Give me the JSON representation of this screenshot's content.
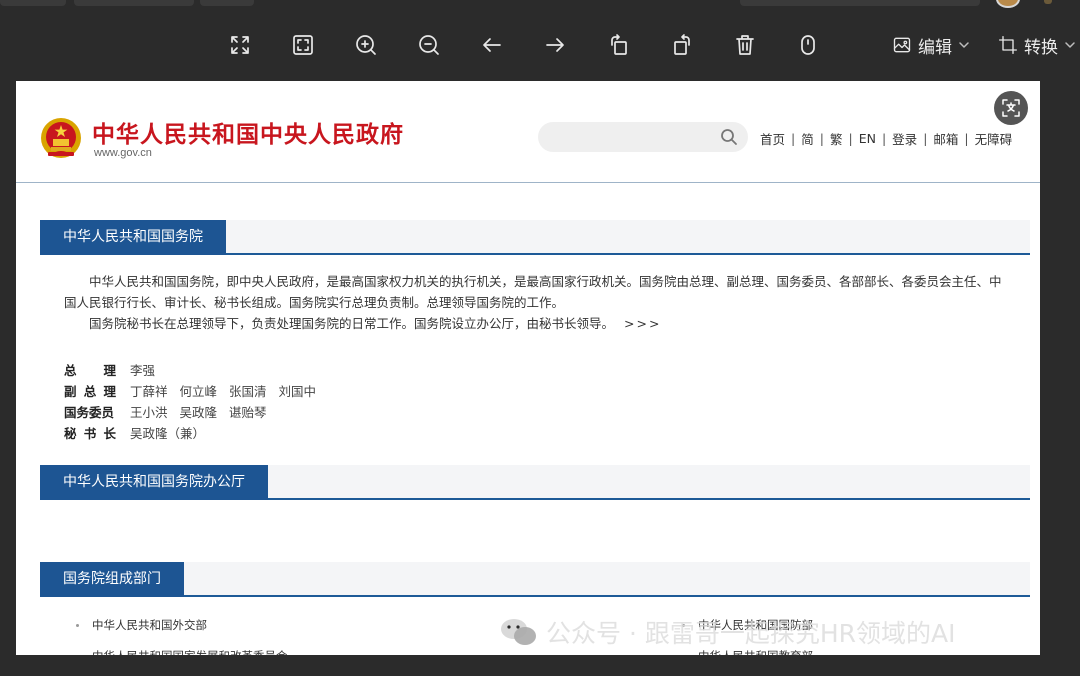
{
  "viewer": {
    "toolbar_tools": [
      "fullscreen-icon",
      "fit-window-icon",
      "zoom-in-icon",
      "zoom-out-icon",
      "arrow-left-icon",
      "arrow-right-icon",
      "rotate-left-icon",
      "rotate-right-icon",
      "delete-icon",
      "mouse-icon"
    ],
    "edit_label": "编辑",
    "convert_label": "转换"
  },
  "site": {
    "title": "中华人民共和国中央人民政府",
    "url": "www.gov.cn",
    "search_placeholder": "",
    "nav": [
      "首页",
      "简",
      "繁",
      "EN",
      "登录",
      "邮箱",
      "无障碍"
    ],
    "brand_red": "#c8161e",
    "section_blue": "#1d5593"
  },
  "section1": {
    "title": "中华人民共和国国务院",
    "para1": "中华人民共和国国务院，即中央人民政府，是最高国家权力机关的执行机关，是最高国家行政机关。国务院由总理、副总理、国务委员、各部部长、各委员会主任、中国人民银行行长、审计长、秘书长组成。国务院实行总理负责制。总理领导国务院的工作。",
    "para2": "国务院秘书长在总理领导下，负责处理国务院的日常工作。国务院设立办公厅，由秘书长领导。",
    "more": ">>>",
    "leaders": [
      {
        "title": [
          "总",
          "理"
        ],
        "names": [
          "李强"
        ]
      },
      {
        "title": [
          "副",
          "总",
          "理"
        ],
        "names": [
          "丁薛祥",
          "何立峰",
          "张国清",
          "刘国中"
        ]
      },
      {
        "title": [
          "国务委员"
        ],
        "names": [
          "王小洪",
          "吴政隆",
          "谌贻琴"
        ]
      },
      {
        "title": [
          "秘",
          "书",
          "长"
        ],
        "names": [
          "吴政隆（兼）"
        ]
      }
    ]
  },
  "section2": {
    "title": "中华人民共和国国务院办公厅"
  },
  "section3": {
    "title": "国务院组成部门",
    "left": [
      "中华人民共和国外交部",
      "中华人民共和国国家发展和改革委员会"
    ],
    "right": [
      "中华人民共和国国防部",
      "中华人民共和国教育部"
    ]
  },
  "watermark": {
    "text": "公众号 · 跟雷哥一起探究HR领域的AI"
  }
}
